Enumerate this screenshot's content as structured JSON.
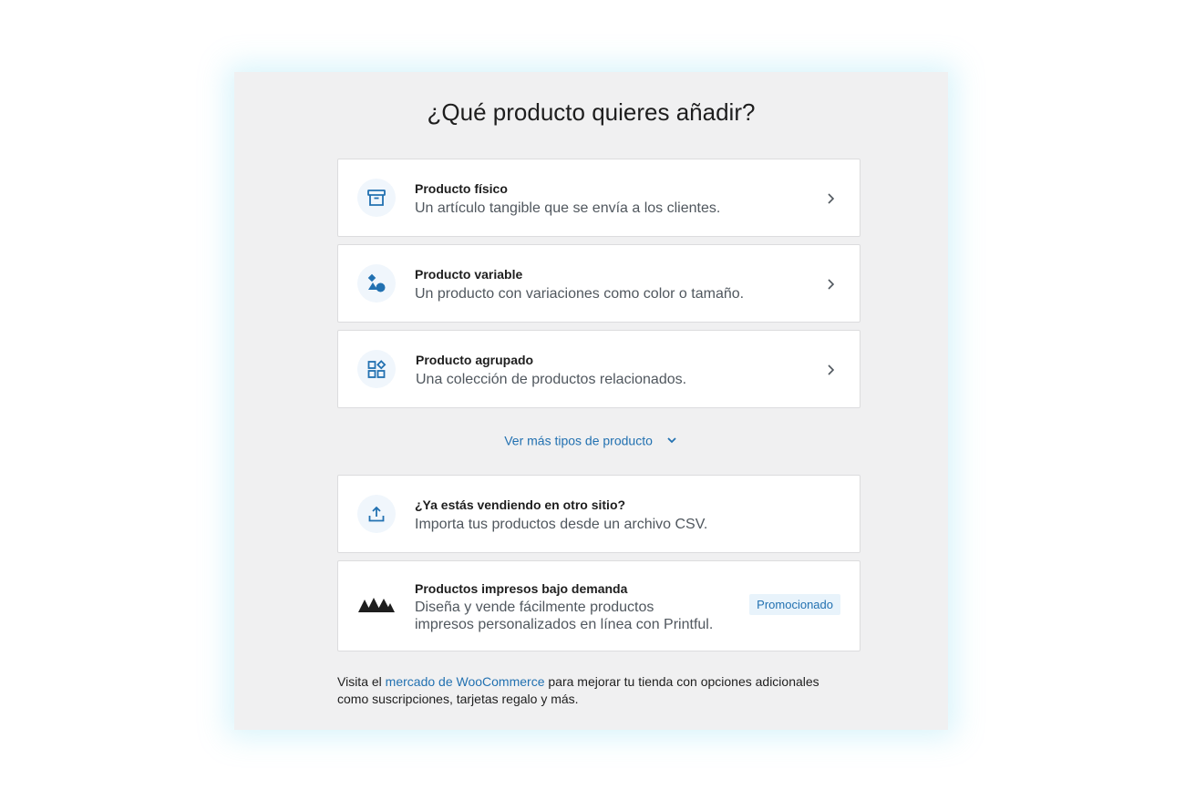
{
  "title": "¿Qué producto quieres añadir?",
  "product_types": [
    {
      "title": "Producto físico",
      "description": "Un artículo tangible que se envía a los clientes.",
      "icon": "archive-box-icon"
    },
    {
      "title": "Producto variable",
      "description": "Un producto con variaciones como color o tamaño.",
      "icon": "shapes-icon"
    },
    {
      "title": "Producto agrupado",
      "description": "Una colección de productos relacionados.",
      "icon": "grouped-blocks-icon"
    }
  ],
  "more_types_link": "Ver más tipos de producto",
  "import": {
    "title": "¿Ya estás vendiendo en otro sitio?",
    "description": "Importa tus productos desde un archivo CSV.",
    "icon": "upload-icon"
  },
  "printful": {
    "title": "Productos impresos bajo demanda",
    "description_line1": "Diseña y vende fácilmente productos",
    "description_line2": "impresos personalizados en línea con Printful.",
    "badge": "Promocionado",
    "icon": "printful-logo"
  },
  "footer": {
    "prefix": "Visita el ",
    "link": "mercado de WooCommerce",
    "suffix": " para mejorar tu tienda con opciones adicionales",
    "line2": "como suscripciones, tarjetas regalo y más."
  },
  "colors": {
    "accent": "#2271b1",
    "panel_bg": "#f0f0f1",
    "icon_bg": "#f0f6fc"
  }
}
